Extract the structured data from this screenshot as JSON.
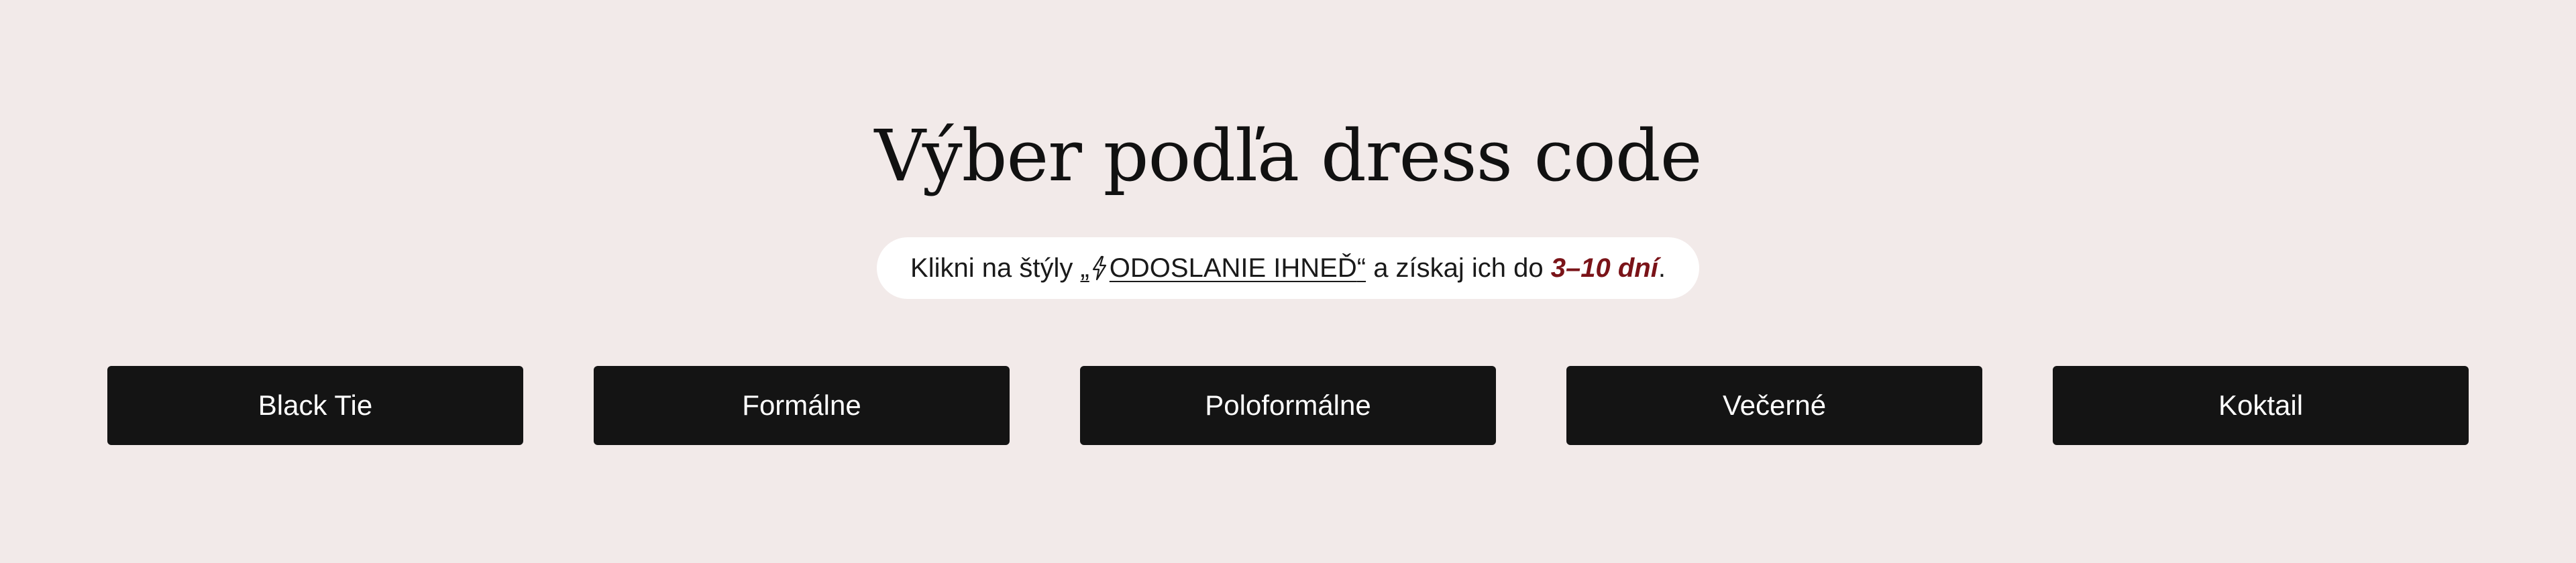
{
  "section": {
    "title": "Výber podľa dress code",
    "notice": {
      "prefix": "Klikni na štýly ",
      "link_open_quote": "„",
      "link_icon": "lightning-bolt-icon",
      "link_label": "ODOSLANIE IHNEĎ",
      "link_close_quote": "“",
      "middle": " a získaj ich do ",
      "highlight": "3–10 dní",
      "suffix": ".",
      "highlight_color": "#7a1318"
    },
    "buttons": [
      {
        "label": "Black Tie"
      },
      {
        "label": "Formálne"
      },
      {
        "label": "Poloformálne"
      },
      {
        "label": "Večerné"
      },
      {
        "label": "Koktail"
      }
    ]
  },
  "colors": {
    "background": "#f2eae9",
    "button_bg": "#141414",
    "button_text": "#ffffff",
    "pill_bg": "#ffffff"
  }
}
